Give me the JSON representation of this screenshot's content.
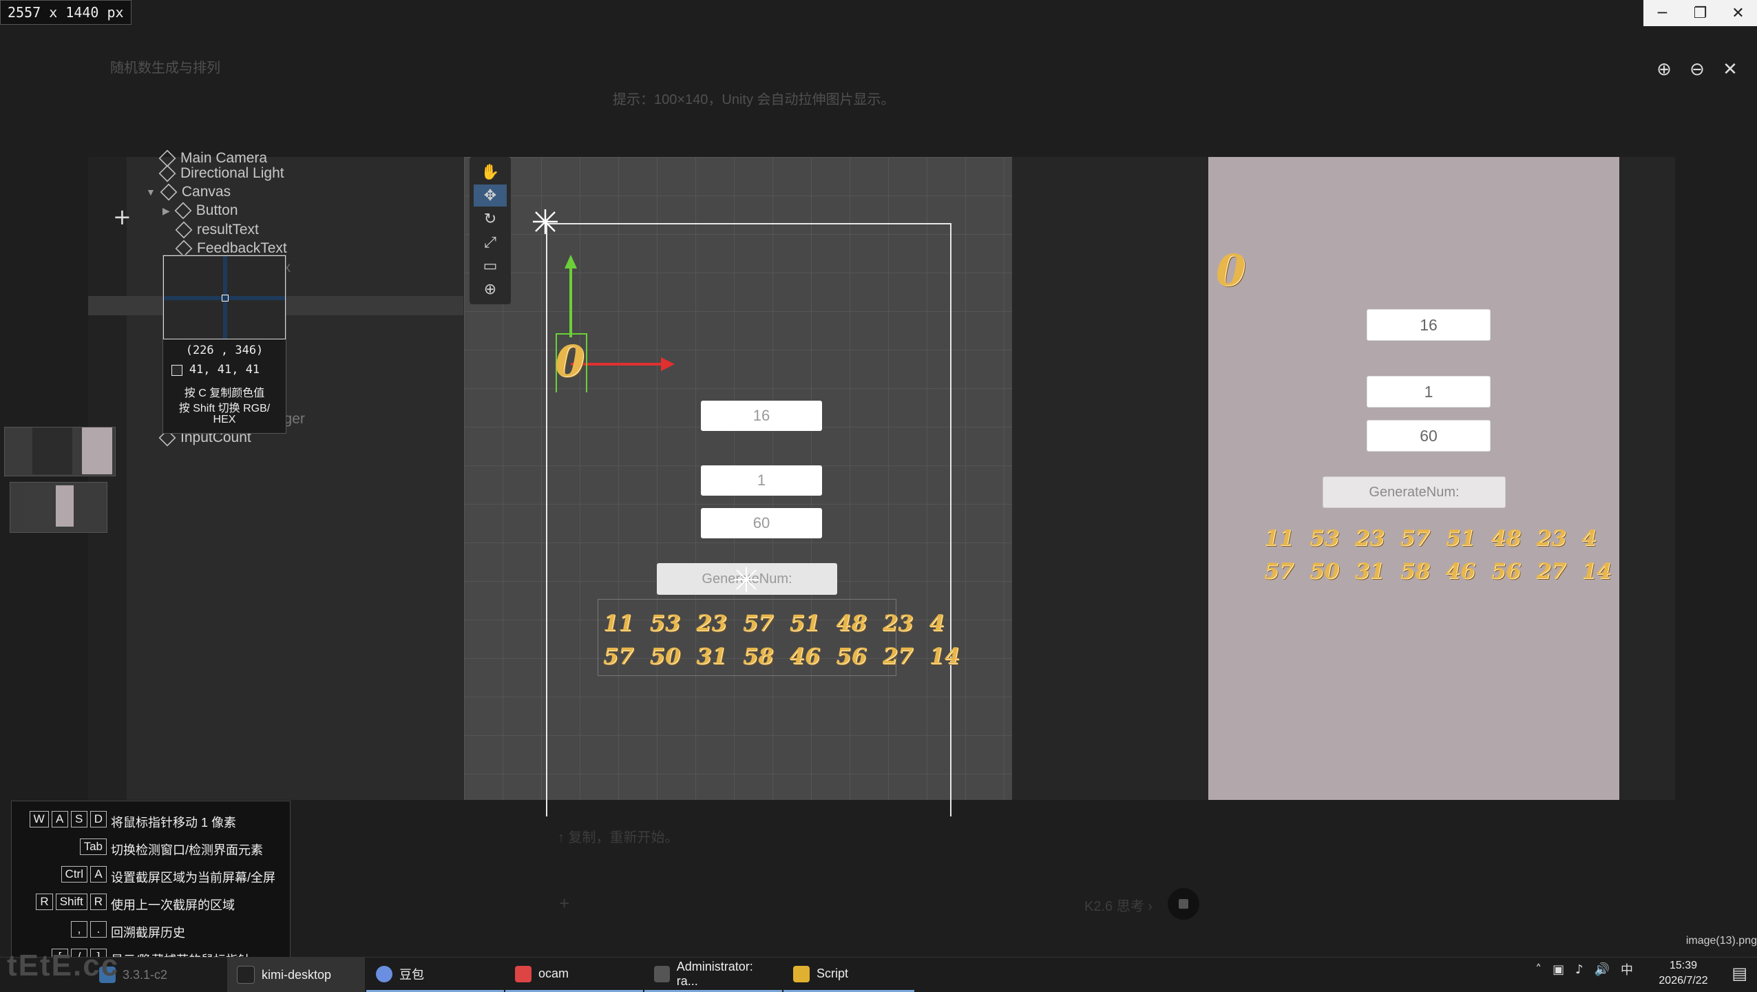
{
  "screen_size_badge": "2557 x 1440  px",
  "window_controls": {
    "minimize": "─",
    "restore": "❐",
    "close": "✕"
  },
  "viewer": {
    "title": "随机数生成与排列",
    "subtitle": "提示：100×140，Unity 会自动拉伸图片显示。",
    "zoom_in_icon": "⊕",
    "zoom_out_icon": "⊖",
    "close_icon": "✕"
  },
  "hierarchy": {
    "items": [
      {
        "label": "Main Camera"
      },
      {
        "label": "Directional Light"
      },
      {
        "label": "Canvas"
      },
      {
        "label": "Button"
      },
      {
        "label": "resultText"
      },
      {
        "label": "FeedbackText"
      },
      {
        "label": "ax"
      },
      {
        "label": "Manager"
      },
      {
        "label": "InputCount"
      }
    ]
  },
  "magnifier": {
    "coord": "(226 , 346)",
    "rgb": "41,   41,   41",
    "hint_copy": "按 C 复制颜色值",
    "hint_switch": "按 Shift 切换 RGB/",
    "hint_hex": "HEX"
  },
  "scene": {
    "tools": [
      "✋",
      "✥",
      "↻",
      "⤢",
      "▭",
      "⊕"
    ],
    "inputs": [
      "16",
      "1",
      "60"
    ],
    "button_label": "GenerateNum:",
    "result_row1": "11 53 23 57 51 48 23 4",
    "result_row2": "57 50 31 58 46 56 27 14",
    "digit_display": "0"
  },
  "game": {
    "inputs": [
      "16",
      "1",
      "60"
    ],
    "button_label": "GenerateNum:",
    "result_row1": "11 53 23 57 51 48 23 4",
    "result_row2": "57 50 31 58 46 56 27 14",
    "digit_display": "0",
    "background": "#b2a7ab"
  },
  "bottom": {
    "faded_text1": "↑ 复制，重新开始。",
    "faded_text2": "K2.6 思考 ›",
    "filename": "image(13).png"
  },
  "shortcuts": [
    {
      "keys": [
        "W",
        "A",
        "S",
        "D"
      ],
      "desc": "将鼠标指针移动 1 像素"
    },
    {
      "keys": [
        "Tab"
      ],
      "desc": "切换检测窗口/检测界面元素"
    },
    {
      "keys": [
        "Ctrl",
        "A"
      ],
      "desc": "设置截屏区域为当前屏幕/全屏"
    },
    {
      "keys": [
        "R",
        "Shift",
        "R"
      ],
      "desc": "使用上一次截屏的区域"
    },
    {
      "keys": [
        ",",
        "."
      ],
      "desc": "回溯截屏历史"
    },
    {
      "keys": [
        "[",
        "/",
        "]"
      ],
      "desc": "显示/隐藏捕获的鼠标指针"
    }
  ],
  "taskbar": {
    "items": [
      {
        "label": "3.3.1-c2",
        "color": "#3a6ea5"
      },
      {
        "label": "kimi-desktop",
        "color": "#222"
      },
      {
        "label": "豆包",
        "color": "#6a8fe0"
      },
      {
        "label": "ocam",
        "color": "#d44"
      },
      {
        "label": "Administrator: ra...",
        "color": "#555"
      },
      {
        "label": "Script",
        "color": "#e0b030"
      }
    ],
    "tray_icons": [
      "˄",
      "▣",
      "♪",
      "🔊",
      "中"
    ],
    "time": "15:39",
    "date": "2026/7/22",
    "watermark": "tEtE.cc"
  }
}
